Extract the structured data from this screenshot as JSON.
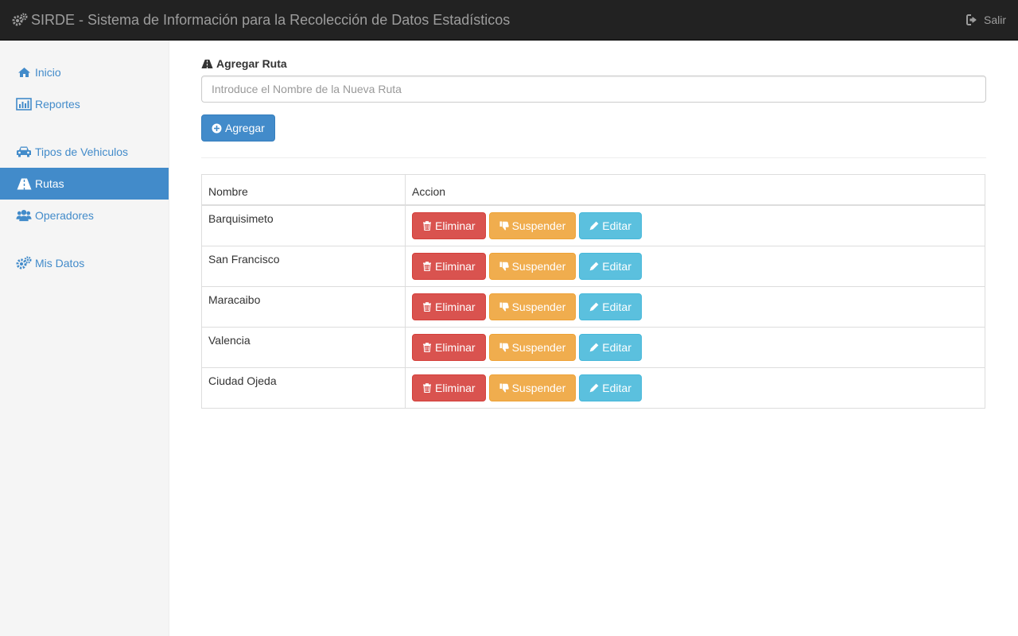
{
  "navbar": {
    "brand": "SIRDE - Sistema de Información para la Recolección de Datos Estadísticos",
    "brand_icon": "gears-icon",
    "logout_label": "Salir",
    "logout_icon": "sign-out-icon"
  },
  "sidebar": {
    "items": [
      {
        "label": "Inicio",
        "icon": "home-icon",
        "active": false
      },
      {
        "label": "Reportes",
        "icon": "bar-chart-icon",
        "active": false
      },
      {
        "label": "Tipos de Vehiculos",
        "icon": "car-icon",
        "active": false
      },
      {
        "label": "Rutas",
        "icon": "road-icon",
        "active": true
      },
      {
        "label": "Operadores",
        "icon": "users-icon",
        "active": false
      },
      {
        "label": "Mis Datos",
        "icon": "gears-icon",
        "active": false
      }
    ]
  },
  "form": {
    "title": "Agregar Ruta",
    "title_icon": "road-icon",
    "input_value": "",
    "input_placeholder": "Introduce el Nombre de la Nueva Ruta",
    "add_label": "Agregar",
    "add_icon": "plus-circle-icon"
  },
  "table": {
    "headers": {
      "name": "Nombre",
      "action": "Accion"
    },
    "actions": {
      "delete": "Eliminar",
      "suspend": "Suspender",
      "edit": "Editar"
    },
    "rows": [
      {
        "name": "Barquisimeto"
      },
      {
        "name": "San Francisco"
      },
      {
        "name": "Maracaibo"
      },
      {
        "name": "Valencia"
      },
      {
        "name": "Ciudad Ojeda"
      }
    ]
  },
  "colors": {
    "primary": "#428bca",
    "danger": "#d9534f",
    "warning": "#f0ad4e",
    "info": "#5bc0de",
    "navbar": "#222222"
  }
}
